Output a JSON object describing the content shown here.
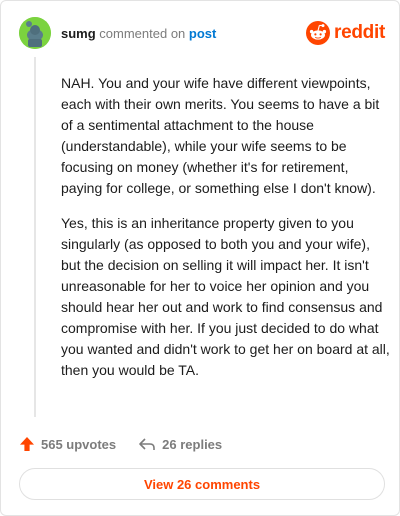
{
  "header": {
    "username": "sumg",
    "action_text": "commented on",
    "post_link": "post",
    "brand": "reddit"
  },
  "comment": {
    "paragraphs": [
      "NAH. You and your wife have different viewpoints, each with their own merits. You seems to have a bit of a sentimental attachment to the house (understandable), while your wife seems to be focusing on money (whether it's for retirement, paying for college, or something else I don't know).",
      "Yes, this is an inheritance property given to you singularly (as opposed to both you and your wife), but the decision on selling it will impact her. It isn't unreasonable for her to voice her opinion and you should hear her out and work to find consensus and compromise with her. If you just decided to do what you wanted and didn't work to get her on board at all, then you would be TA."
    ]
  },
  "footer": {
    "upvotes": "565 upvotes",
    "replies": "26 replies"
  },
  "view_comments": "View 26 comments",
  "colors": {
    "brand": "#ff4500",
    "link": "#0079d3",
    "avatar_bg": "#7bd33f"
  },
  "icons": [
    "avatar-icon",
    "reddit-logo-icon",
    "upvote-arrow-icon",
    "reply-arrow-icon"
  ]
}
